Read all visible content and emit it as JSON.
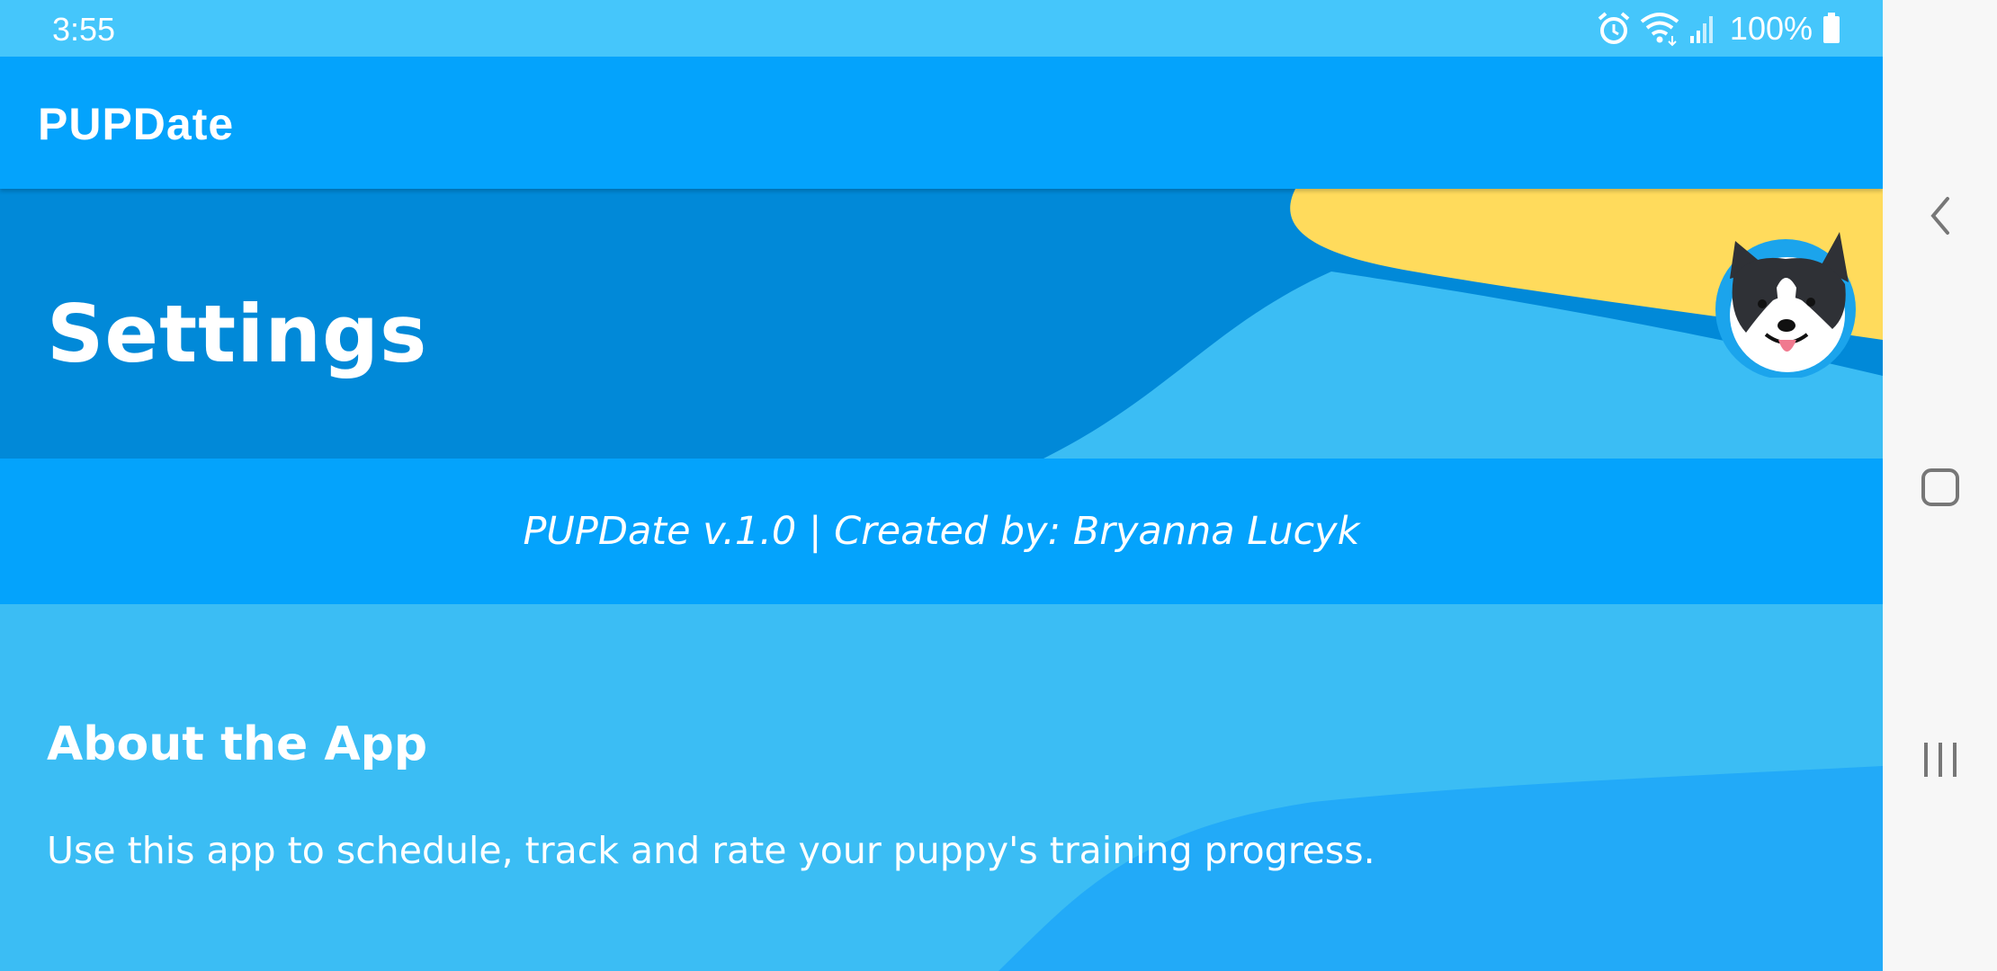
{
  "status_bar": {
    "time": "3:55",
    "battery": "100%",
    "icons": [
      "alarm-icon",
      "wifi-icon",
      "signal-icon",
      "battery-icon"
    ]
  },
  "app_bar": {
    "title": "PUPDate"
  },
  "banner": {
    "heading": "Settings",
    "avatar_icon": "dog-avatar"
  },
  "info": {
    "version_line": "PUPDate v.1.0 | Created by: Bryanna Lucyk"
  },
  "about": {
    "title": "About the App",
    "body": "Use this app to schedule, track and rate your puppy's training progress."
  },
  "nav_bar": {
    "buttons": [
      "back-icon",
      "home-icon",
      "recents-icon"
    ]
  },
  "colors": {
    "status_bar": "#45c6fb",
    "app_bar": "#04a3fc",
    "banner_dark": "#0189d8",
    "wave_light": "#3bbdf4",
    "wave_yellow": "#ffdb5c",
    "wave_bright": "#22aaf8"
  }
}
